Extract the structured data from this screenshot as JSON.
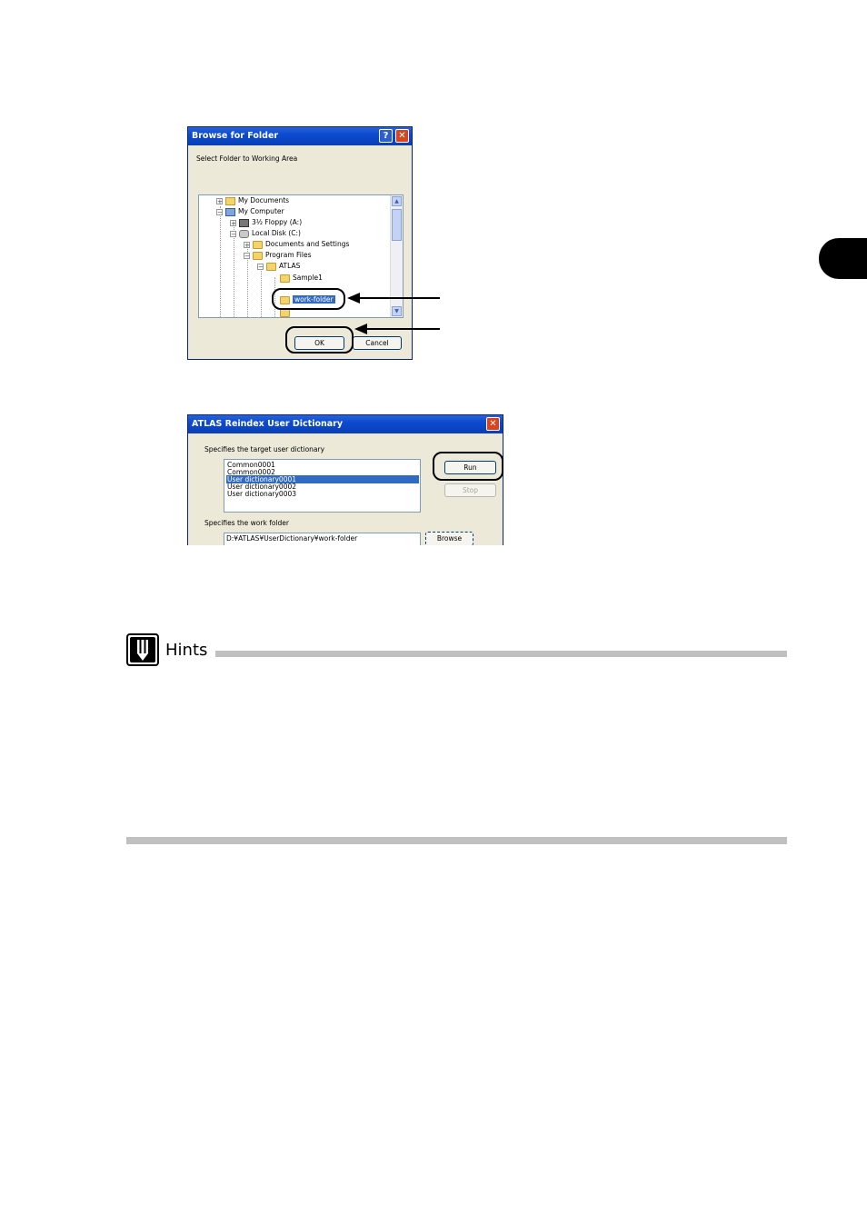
{
  "browse_dialog": {
    "title": "Browse for Folder",
    "help_glyph": "?",
    "close_glyph": "✕",
    "instruction": "Select Folder to Working Area",
    "tree": [
      {
        "label": "My Documents",
        "icon": "my-documents-icon",
        "expander": "+"
      },
      {
        "label": "My Computer",
        "icon": "computer-icon",
        "expander": "−"
      },
      {
        "label": "3½ Floppy (A:)",
        "icon": "floppy-icon",
        "expander": "+"
      },
      {
        "label": "Local Disk (C:)",
        "icon": "disk-icon",
        "expander": "−"
      },
      {
        "label": "Documents and Settings",
        "icon": "folder-icon",
        "expander": "+"
      },
      {
        "label": "Program Files",
        "icon": "folder-icon",
        "expander": "−"
      },
      {
        "label": "ATLAS",
        "icon": "folder-icon",
        "expander": "−"
      },
      {
        "label": "Sample1",
        "icon": "folder-icon",
        "expander": ""
      },
      {
        "label": "work-folder",
        "icon": "folder-open-icon",
        "expander": "",
        "selected": true
      }
    ],
    "ok_label": "OK",
    "cancel_label": "Cancel"
  },
  "reindex_dialog": {
    "title": "ATLAS Reindex User Dictionary",
    "close_glyph": "✕",
    "target_label": "Specifies the target user dictionary",
    "dictionaries": [
      "Common0001",
      "Common0002",
      "User dictionary0001",
      "User dictionary0002",
      "User dictionary0003"
    ],
    "selected_index": 2,
    "run_label": "Run",
    "stop_label": "Stop",
    "work_folder_label": "Specifies the work folder",
    "work_folder_value": "D:¥ATLAS¥UserDictionary¥work-folder",
    "browse_label": "Browse"
  },
  "hints": {
    "title": "Hints"
  }
}
